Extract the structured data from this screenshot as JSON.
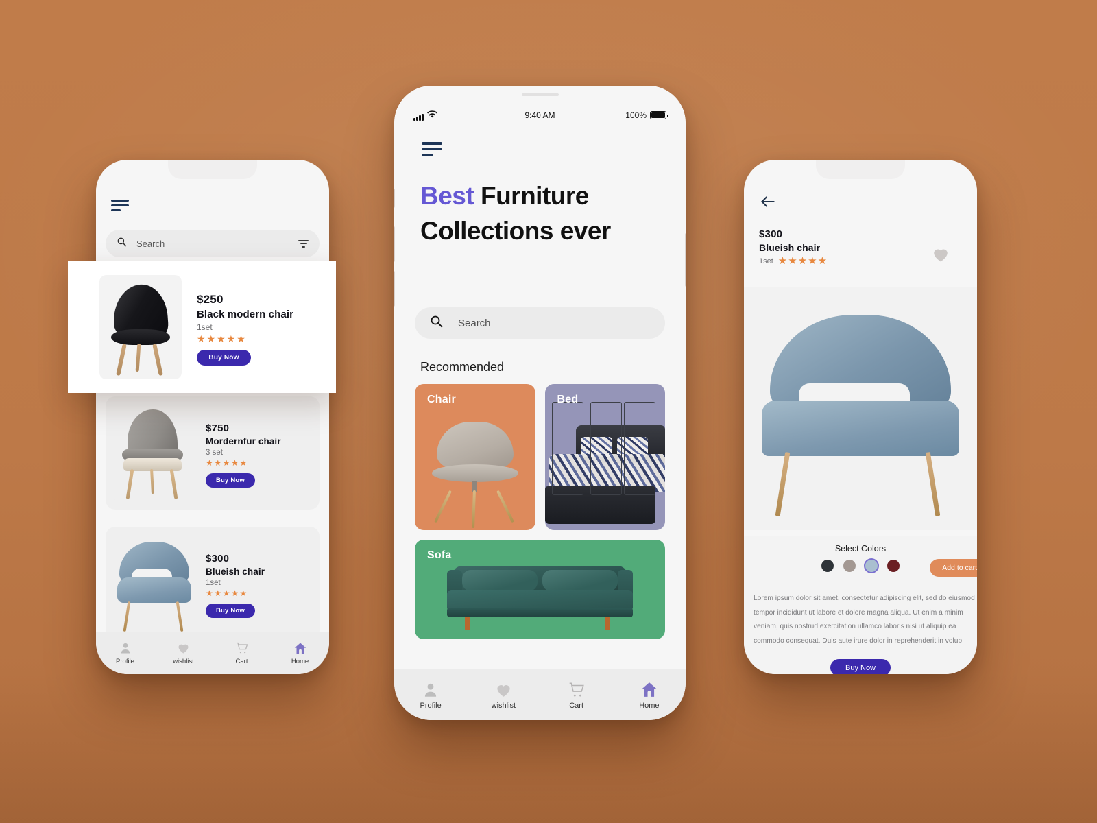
{
  "theme": {
    "background": "#bd7948",
    "accent_purple": "#6558d4",
    "button_indigo": "#3b29ad",
    "star_orange": "#e8883f",
    "add_cart_orange": "#e08b5a",
    "card_chair_orange": "#dd8a5c",
    "card_bed_purple": "#9595b8",
    "card_sofa_green": "#52ab79"
  },
  "phone_left": {
    "menu_icon": "hamburger-icon",
    "search": {
      "placeholder": "Search",
      "icon": "search-icon",
      "filter_icon": "filter-icon"
    },
    "products": [
      {
        "price": "$250",
        "name": "Black modern chair",
        "set": "1set",
        "stars": "★★★★★",
        "buy_label": "Buy Now",
        "image": "black-modern-chair"
      },
      {
        "price": "$750",
        "name": "Mordernfur chair",
        "set": "3 set",
        "stars": "★★★★★",
        "buy_label": "Buy Now",
        "image": "grey-wing-chair"
      },
      {
        "price": "$300",
        "name": "Blueish chair",
        "set": "1set",
        "stars": "★★★★★",
        "buy_label": "Buy Now",
        "image": "blueish-chair"
      }
    ],
    "bottom_nav": [
      {
        "label": "Profile",
        "icon": "person-icon",
        "active": false
      },
      {
        "label": "wishlist",
        "icon": "heart-icon",
        "active": false
      },
      {
        "label": "Cart",
        "icon": "cart-icon",
        "active": false
      },
      {
        "label": "Home",
        "icon": "home-icon",
        "active": true
      }
    ]
  },
  "highlight_card": {
    "price": "$250",
    "name": "Black modern chair",
    "set": "1set",
    "stars": "★★★★★",
    "buy_label": "Buy Now"
  },
  "phone_center": {
    "statusbar": {
      "signal_icon": "signal-bars-icon",
      "wifi_icon": "wifi-icon",
      "time": "9:40 AM",
      "battery_percent": "100%",
      "battery_icon": "battery-full-icon"
    },
    "menu_icon": "hamburger-icon",
    "title_accent": "Best",
    "title_rest": " Furniture Collections ever",
    "search": {
      "placeholder": "Search",
      "icon": "search-icon"
    },
    "section_title": "Recommended",
    "categories": [
      {
        "label": "Chair",
        "color": "#dd8a5c",
        "image": "swivel-chair"
      },
      {
        "label": "Bed",
        "color": "#9595b8",
        "image": "dark-wood-bed"
      },
      {
        "label": "Sofa",
        "color": "#52ab79",
        "image": "green-velvet-sofa"
      }
    ],
    "bottom_nav": [
      {
        "label": "Profile",
        "icon": "person-icon",
        "active": false
      },
      {
        "label": "wishlist",
        "icon": "heart-icon",
        "active": false
      },
      {
        "label": "Cart",
        "icon": "cart-icon",
        "active": false
      },
      {
        "label": "Home",
        "icon": "home-icon",
        "active": true
      }
    ]
  },
  "phone_right": {
    "back_icon": "arrow-left-icon",
    "price": "$300",
    "name": "Blueish chair",
    "set": "1set",
    "stars": "★★★★★",
    "favorite_icon": "heart-icon",
    "hero_image": "blueish-chair-large",
    "select_colors_label": "Select Colors",
    "colors": [
      {
        "name": "charcoal",
        "hex": "#2e3338",
        "selected": false
      },
      {
        "name": "taupe",
        "hex": "#a39892",
        "selected": false
      },
      {
        "name": "light-blue",
        "hex": "#a9bfd0",
        "selected": true
      },
      {
        "name": "maroon",
        "hex": "#6b1f23",
        "selected": false
      }
    ],
    "add_to_cart_label": "Add to cart",
    "description": "Lorem ipsum dolor sit amet, consectetur adipiscing elit, sed do eiusmod tempor incididunt ut labore et dolore magna aliqua. Ut enim a minim veniam, quis nostrud exercitation ullamco laboris nisi ut aliquip ea commodo consequat. Duis aute irure dolor in reprehenderit in volup",
    "buy_label": "Buy Now"
  }
}
